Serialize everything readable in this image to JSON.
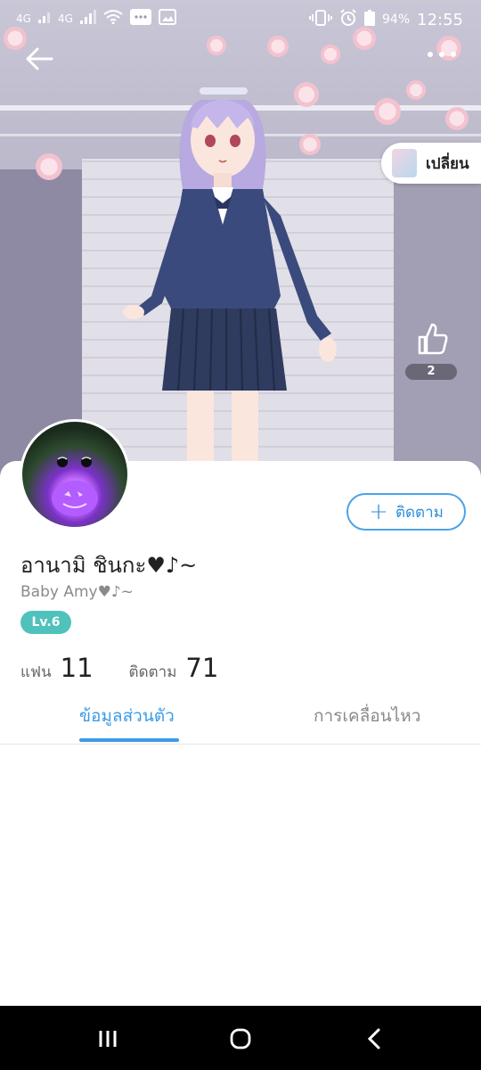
{
  "status_bar": {
    "network_1": "4G",
    "network_2": "4G",
    "battery": "94%",
    "time": "12:55",
    "icons": [
      "signal-icon",
      "signal-icon",
      "wifi-icon",
      "message-icon",
      "image-icon",
      "vibrate-icon",
      "alarm-icon",
      "battery-icon"
    ]
  },
  "header": {
    "back_icon": "back-arrow-icon",
    "more_icon": "more-dots-icon",
    "change_label": "เปลี่ยน"
  },
  "likes": {
    "count": "2"
  },
  "profile": {
    "name": "อานามิ ชินกะ♥♪~",
    "subtitle": "Baby Amy♥♪~",
    "level": "Lv.6",
    "fans_label": "แฟน",
    "fans_count": "11",
    "following_label": "ติดตาม",
    "following_count": "71",
    "follow_button_label": "ติดตาม"
  },
  "tabs": [
    {
      "label": "ข้อมูลส่วนตัว",
      "active": true
    },
    {
      "label": "การเคลื่อนไหว",
      "active": false
    }
  ],
  "colors": {
    "accent": "#3c9be6",
    "level_badge": "#4fc2bc",
    "nav_bar": "#000000"
  }
}
